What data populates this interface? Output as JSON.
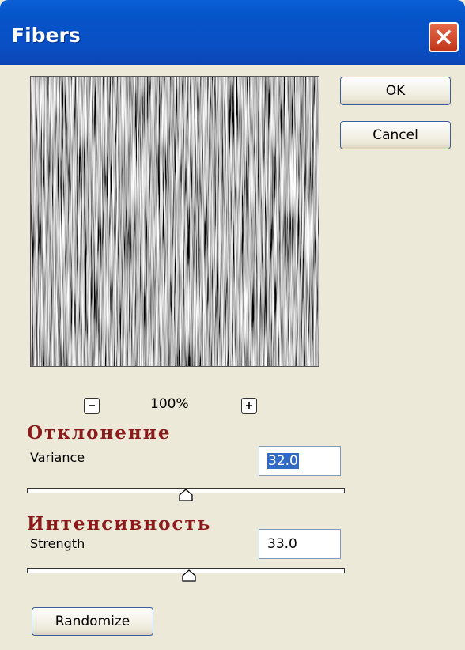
{
  "window": {
    "title": "Fibers",
    "close_icon": "close-icon"
  },
  "buttons": {
    "ok": "OK",
    "cancel": "Cancel",
    "randomize": "Randomize"
  },
  "zoom": {
    "level": "100%",
    "zoom_out_icon": "minus-icon",
    "zoom_in_icon": "plus-icon"
  },
  "variance": {
    "heading": "Отклонение",
    "label": "Variance",
    "value": "32.0",
    "slider_fraction": 0.5
  },
  "strength": {
    "heading": "Интенсивность",
    "label": "Strength",
    "value": "33.0",
    "slider_fraction": 0.51
  },
  "colors": {
    "titlebar": "#0553c7",
    "close_button": "#c2351a",
    "heading_text": "#8b1a1a",
    "dialog_bg": "#ece9d8",
    "selection": "#316ac5"
  }
}
